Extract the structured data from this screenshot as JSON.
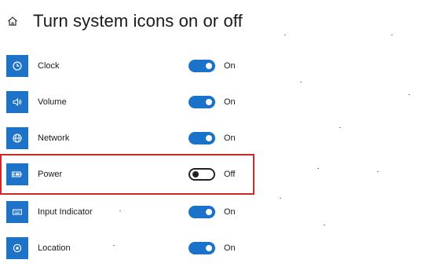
{
  "header": {
    "title": "Turn system icons on or off",
    "home_icon": "home-icon"
  },
  "accent_color": "#1e73c8",
  "highlight_color": "#cc2a2a",
  "settings": [
    {
      "id": "clock",
      "label": "Clock",
      "icon": "clock-icon",
      "state": "On",
      "enabled": true
    },
    {
      "id": "volume",
      "label": "Volume",
      "icon": "volume-icon",
      "state": "On",
      "enabled": true
    },
    {
      "id": "network",
      "label": "Network",
      "icon": "network-globe-icon",
      "state": "On",
      "enabled": true
    },
    {
      "id": "power",
      "label": "Power",
      "icon": "battery-icon",
      "state": "Off",
      "enabled": false
    },
    {
      "id": "input-indicator",
      "label": "Input Indicator",
      "icon": "keyboard-icon",
      "state": "On",
      "enabled": true
    },
    {
      "id": "location",
      "label": "Location",
      "icon": "location-icon",
      "state": "On",
      "enabled": true
    }
  ]
}
